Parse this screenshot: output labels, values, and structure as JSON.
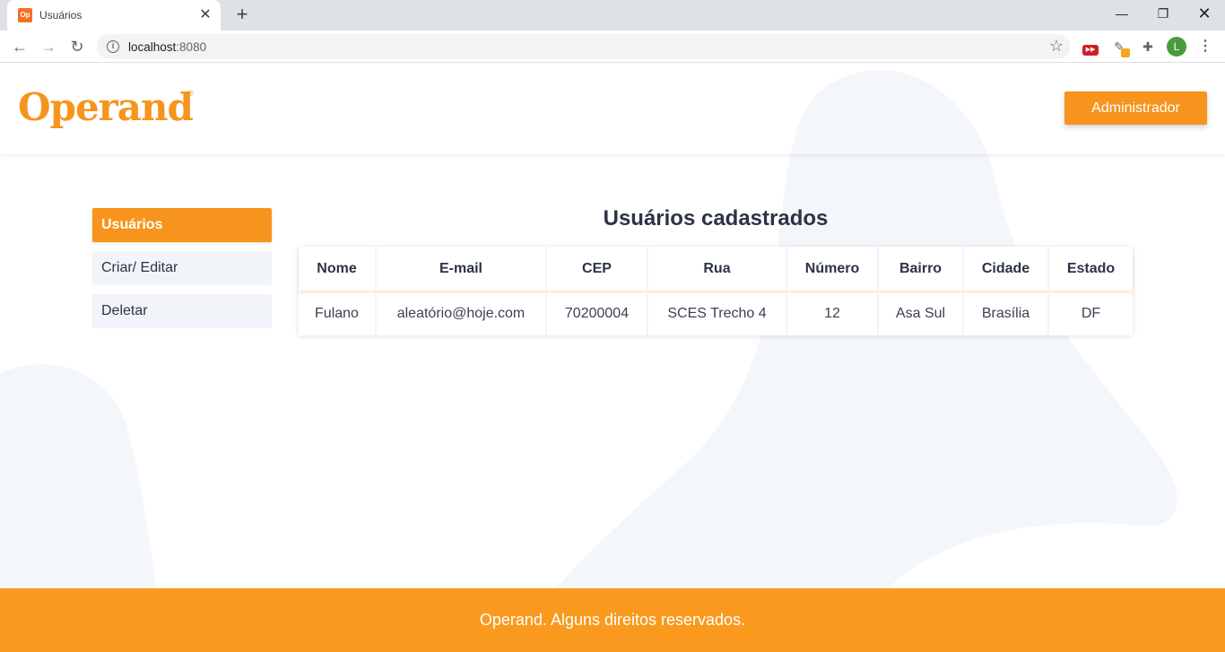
{
  "browser": {
    "tab_title": "Usuários",
    "favicon_text": "Op",
    "url_host": "localhost",
    "url_port": ":8080",
    "profile_initial": "L",
    "win_min": "—",
    "win_max": "❐",
    "win_close": "✕",
    "new_tab": "+",
    "tab_close": "✕"
  },
  "header": {
    "logo": "Operand",
    "logo_mark": "®",
    "admin_button": "Administrador"
  },
  "sidebar": {
    "items": [
      {
        "label": "Usuários",
        "active": true
      },
      {
        "label": "Criar/ Editar",
        "active": false
      },
      {
        "label": "Deletar",
        "active": false
      }
    ]
  },
  "main": {
    "title": "Usuários cadastrados",
    "columns": [
      "Nome",
      "E-mail",
      "CEP",
      "Rua",
      "Número",
      "Bairro",
      "Cidade",
      "Estado"
    ],
    "rows": [
      [
        "Fulano",
        "aleatório@hoje.com",
        "70200004",
        "SCES Trecho 4",
        "12",
        "Asa Sul",
        "Brasília",
        "DF"
      ]
    ]
  },
  "footer": {
    "text": "Operand. Alguns direitos reservados."
  },
  "colors": {
    "accent": "#f7941d",
    "footer": "#f99a1f",
    "text": "#2c3345",
    "blob": "#f3f6fa"
  }
}
